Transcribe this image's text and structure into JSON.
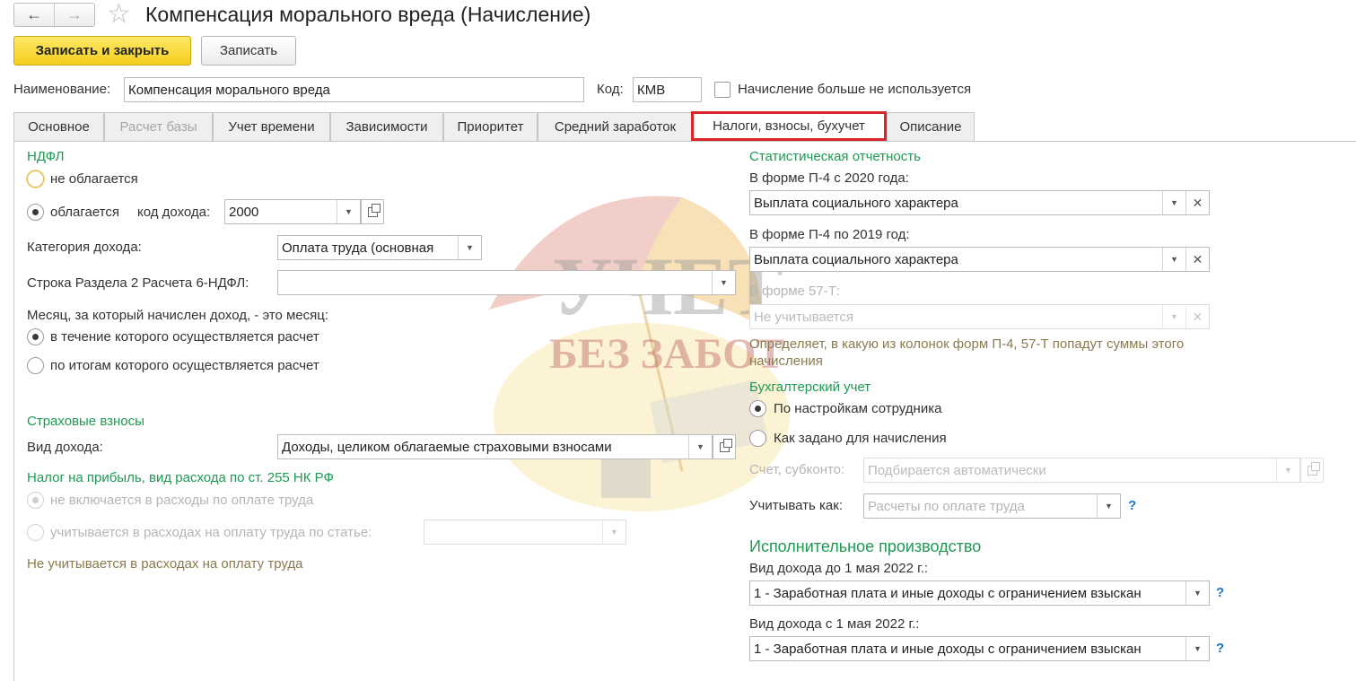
{
  "window": {
    "title": "Компенсация морального вреда (Начисление)",
    "back_icon": "←",
    "forward_icon": "→",
    "star_icon": "☆"
  },
  "toolbar": {
    "save_close": "Записать и закрыть",
    "save": "Записать"
  },
  "header": {
    "name_label": "Наименование:",
    "name_value": "Компенсация морального вреда",
    "code_label": "Код:",
    "code_value": "КМВ",
    "unused_label": "Начисление больше не используется"
  },
  "tabs": [
    {
      "label": "Основное"
    },
    {
      "label": "Расчет базы"
    },
    {
      "label": "Учет времени"
    },
    {
      "label": "Зависимости"
    },
    {
      "label": "Приоритет"
    },
    {
      "label": "Средний заработок"
    },
    {
      "label": "Налоги, взносы, бухучет"
    },
    {
      "label": "Описание"
    }
  ],
  "ndfl": {
    "title": "НДФЛ",
    "not_taxed": "не облагается",
    "taxed": "облагается",
    "income_code_label": "код дохода:",
    "income_code": "2000",
    "category_label": "Категория дохода:",
    "category_value": "Оплата труда (основная",
    "line_label": "Строка Раздела 2 Расчета 6-НДФЛ:",
    "line_value": "",
    "month_label": "Месяц, за который начислен доход, - это месяц:",
    "month_opt1": "в течение которого осуществляется расчет",
    "month_opt2": "по итогам которого осуществляется расчет"
  },
  "insurance": {
    "title": "Страховые взносы",
    "income_kind_label": "Вид дохода:",
    "income_kind_value": "Доходы, целиком облагаемые страховыми взносами"
  },
  "profit_tax": {
    "title": "Налог на прибыль, вид расхода по ст. 255 НК РФ",
    "opt1": "не включается в расходы по оплате труда",
    "opt2": "учитывается в расходах на оплату труда по статье:",
    "note": "Не учитывается в расходах на оплату труда"
  },
  "stats": {
    "title": "Статистическая отчетность",
    "p4_2020_label": "В форме П-4 с 2020 года:",
    "p4_2020_value": "Выплата социального характера",
    "p4_2019_label": "В форме П-4 по 2019 год:",
    "p4_2019_value": "Выплата социального характера",
    "f57_label": "В форме 57-Т:",
    "f57_value": "Не учитывается",
    "note": "Определяет, в какую из колонок форм П-4, 57-Т попадут суммы этого начисления"
  },
  "accounting": {
    "title": "Бухгалтерский учет",
    "opt1": "По настройкам сотрудника",
    "opt2": "Как задано для начисления",
    "account_label": "Счет, субконто:",
    "account_placeholder": "Подбирается автоматически",
    "account_as_label": "Учитывать как:",
    "account_as_placeholder": "Расчеты по оплате труда",
    "help": "?"
  },
  "enforcement": {
    "title": "Исполнительное производство",
    "before_label": "Вид дохода до 1 мая 2022 г.:",
    "before_value": "1 - Заработная плата и иные доходы с ограничением взыскан",
    "after_label": "Вид дохода с 1 мая 2022 г.:",
    "after_value": "1 - Заработная плата и иные доходы с ограничением взыскан",
    "help": "?"
  },
  "watermark": {
    "line1": "УЧЕТ",
    "line2": "БЕЗ ЗАБОТ"
  },
  "colors": {
    "accent_green": "#1e9a52",
    "primary_button": "#f5ce1c",
    "active_tab_border": "#d9262b",
    "help_blue": "#1a75c9"
  }
}
